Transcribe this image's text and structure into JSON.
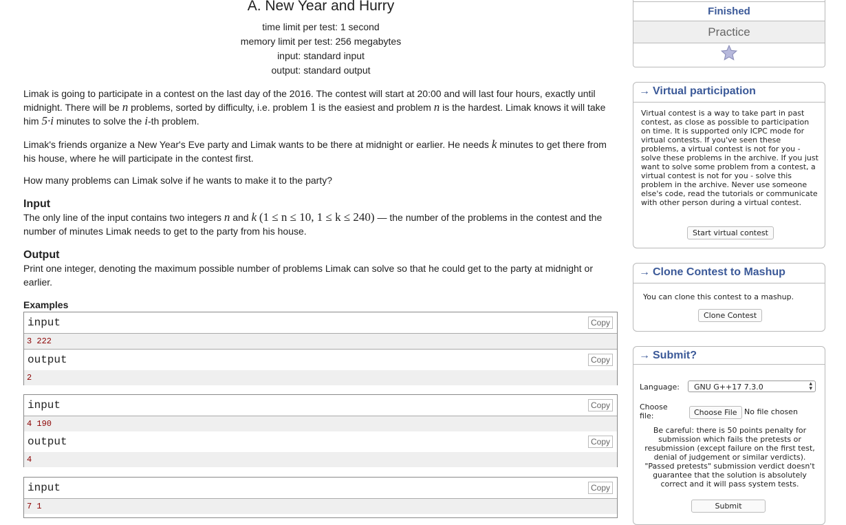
{
  "problem": {
    "title": "A. New Year and Hurry",
    "time_limit": "time limit per test: 1 second",
    "memory_limit": "memory limit per test: 256 megabytes",
    "input": "input: standard input",
    "output": "output: standard output"
  },
  "statement": {
    "p1_a": "Limak is going to participate in a contest on the last day of the 2016. The contest will start at 20:00 and will last four hours, exactly until midnight. There will be ",
    "var_n": "n",
    "p1_b": " problems, sorted by difficulty, i.e. problem ",
    "num_1": "1",
    "p1_c": " is the easiest and problem ",
    "p1_d": " is the hardest. Limak knows it will take him ",
    "expr_5i": "5·i",
    "p1_e": " minutes to solve the ",
    "var_i": "i",
    "p1_f": "-th problem.",
    "p2_a": "Limak's friends organize a New Year's Eve party and Limak wants to be there at midnight or earlier. He needs ",
    "var_k": "k",
    "p2_b": " minutes to get there from his house, where he will participate in the contest first.",
    "p3": "How many problems can Limak solve if he wants to make it to the party?"
  },
  "input_section": {
    "heading": "Input",
    "text_a": "The only line of the input contains two integers ",
    "text_b": " and ",
    "constraint": "(1 ≤ n ≤ 10, 1 ≤ k ≤ 240)",
    "text_c": " — the number of the problems in the contest and the number of minutes Limak needs to get to the party from his house."
  },
  "output_section": {
    "heading": "Output",
    "text": "Print one integer, denoting the maximum possible number of problems Limak can solve so that he could get to the party at midnight or earlier."
  },
  "examples": {
    "heading": "Examples",
    "input_label": "input",
    "output_label": "output",
    "copy_label": "Copy",
    "items": [
      {
        "input": "3 222",
        "output": "2"
      },
      {
        "input": "4 190",
        "output": "4"
      },
      {
        "input": "7 1"
      }
    ]
  },
  "sidebar": {
    "status": {
      "finished": "Finished",
      "practice": "Practice",
      "star_icon": "star-icon"
    },
    "virtual": {
      "title": "Virtual participation",
      "text": "Virtual contest is a way to take part in past contest, as close as possible to participation on time. It is supported only ICPC mode for virtual contests. If you've seen these problems, a virtual contest is not for you - solve these problems in the archive. If you just want to solve some problem from a contest, a virtual contest is not for you - solve this problem in the archive. Never use someone else's code, read the tutorials or communicate with other person during a virtual contest.",
      "button": "Start virtual contest"
    },
    "clone": {
      "title": "Clone Contest to Mashup",
      "text": "You can clone this contest to a mashup.",
      "button": "Clone Contest"
    },
    "submit": {
      "title": "Submit?",
      "language_label": "Language:",
      "language_value": "GNU G++17 7.3.0",
      "file_label_1": "Choose",
      "file_label_2": "file:",
      "choose_file": "Choose File",
      "no_file": "No file chosen",
      "warning": "Be careful: there is 50 points penalty for submission which fails the pretests or resubmission (except failure on the first test, denial of judgement or similar verdicts). \"Passed pretests\" submission verdict doesn't guarantee that the solution is absolutely correct and it will pass system tests.",
      "button": "Submit"
    }
  },
  "colors": {
    "link_blue": "#3b5998",
    "example_value": "#8b0000",
    "box_border": "#b9b9b9"
  }
}
